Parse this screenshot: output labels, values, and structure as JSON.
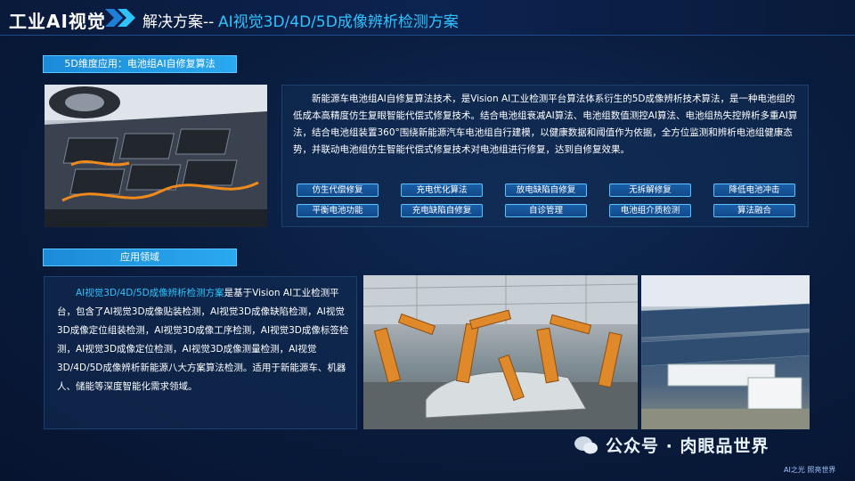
{
  "header": {
    "brand": "工业AI视觉",
    "title_prefix": "解决方案--",
    "title_main": "AI视觉3D/4D/5D成像辨析检测方案"
  },
  "section1": {
    "tag": "5D维度应用：电池组AI自修复算法",
    "description": "新能源车电池组AI自修复算法技术，是Vision AI工业检测平台算法体系衍生的5D成像辨析技术算法，是一种电池组的低成本高精度仿生复眼智能代偿式修复技术。结合电池组衰减AI算法、电池组数值测控AI算法、电池组热失控辨析多重AI算法，结合电池组装置360°围绕新能源汽车电池组自行建模，以健康数据和阈值作为依据，全方位监测和辨析电池组健康态势，并联动电池组仿生智能代偿式修复技术对电池组进行修复，达到自修复效果。",
    "chips_row1": [
      "仿生代偿修复",
      "充电优化算法",
      "放电缺陷自修复",
      "无拆解修复",
      "降低电池冲击"
    ],
    "chips_row2": [
      "平衡电池功能",
      "充电缺陷自修复",
      "自诊管理",
      "电池组介质检测",
      "算法融合"
    ]
  },
  "section2": {
    "tag": "应用领域",
    "highlight": "AI视觉3D/4D/5D成像辨析检测方案",
    "body": "是基于Vision AI工业检测平台，包含了AI视觉3D成像贴装检测，AI视觉3D成像缺陷检测，AI视觉3D成像定位组装检测，AI视觉3D成像工序检测，AI视觉3D成像标签检测，AI视觉3D成像定位检测，AI视觉3D成像测量检测，AI视觉3D/4D/5D成像辨析新能源八大方案算法检测。适用于新能源车、机器人、储能等深度智能化需求领域。"
  },
  "watermark": "公众号 · 肉眼品世界",
  "footer": "AI之光 照亮世界",
  "colors": {
    "accent": "#2ec3ff",
    "tag_bg": "#1c8ad8",
    "panel_bg": "#122d55"
  }
}
